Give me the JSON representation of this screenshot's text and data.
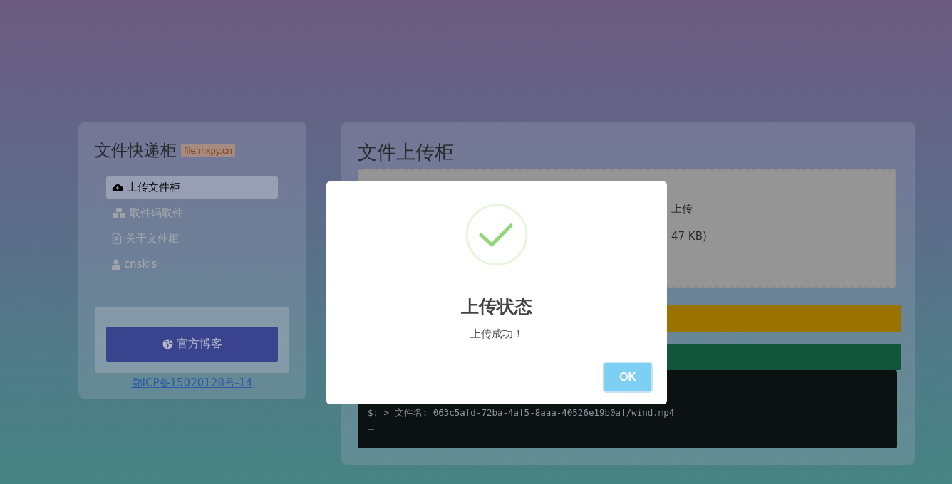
{
  "sidebar": {
    "title": "文件快递柜",
    "domain_badge": "file.mxpy.cn",
    "items": [
      {
        "label": "上传文件柜",
        "kind": "upload",
        "selected": true
      },
      {
        "label": "取件码取件",
        "kind": "pickup",
        "selected": false
      },
      {
        "label": "关于文件柜",
        "kind": "about",
        "selected": false
      },
      {
        "label": "cnskis",
        "kind": "user",
        "selected": false
      }
    ],
    "blog_button": "官方博客",
    "icp_link": "鄂ICP备15020128号-14"
  },
  "main": {
    "title": "文件上传柜",
    "dropzone_lines": [
      "上传",
      "47 KB)"
    ],
    "action_bars": [
      {
        "color": "#9a7200"
      },
      {
        "color": "#11553a"
      }
    ],
    "terminal_lines": [
      "$: > 文件名: 063c5afd-72ba-4af5-8aaa-40526e19b0af/wind.mp4"
    ]
  },
  "dialog": {
    "title": "上传状态",
    "message": "上传成功！",
    "button": "OK"
  }
}
